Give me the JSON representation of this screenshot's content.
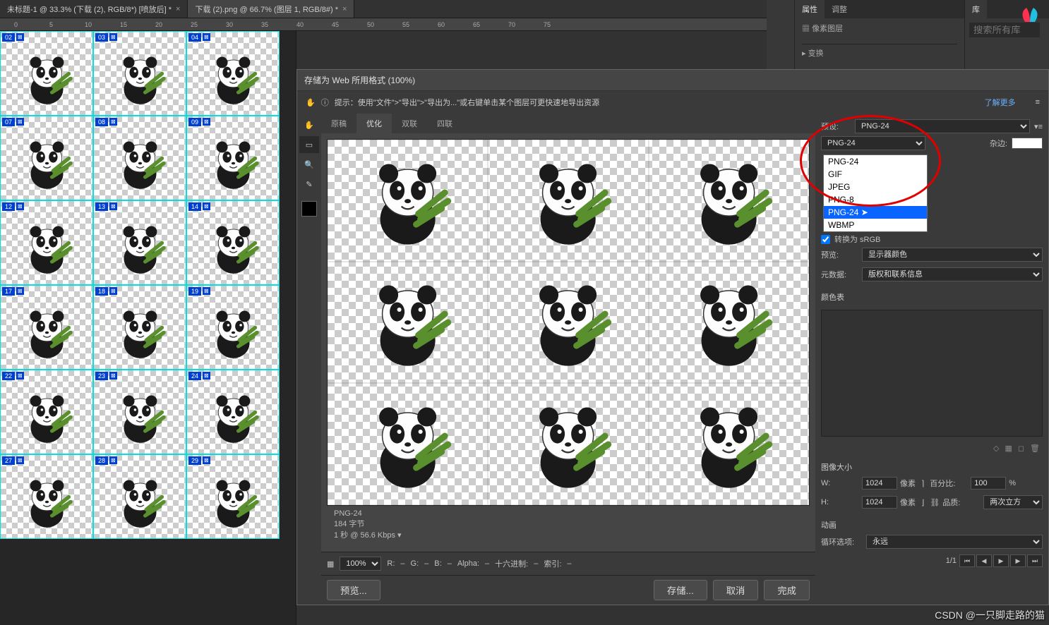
{
  "tabs": [
    {
      "label": "未标题-1 @ 33.3% (下载 (2), RGB/8*) [喷放后] *"
    },
    {
      "label": "下载 (2).png @ 66.7% (图层 1, RGB/8#) *"
    }
  ],
  "ruler_marks": [
    "0",
    "5",
    "10",
    "15",
    "20",
    "25",
    "30",
    "35",
    "40",
    "45",
    "50",
    "55",
    "60",
    "65",
    "70",
    "75"
  ],
  "thumbs": [
    "02",
    "03",
    "04",
    "07",
    "08",
    "09",
    "12",
    "13",
    "14",
    "17",
    "18",
    "19",
    "22",
    "23",
    "24",
    "27",
    "28",
    "29"
  ],
  "dialog": {
    "title": "存储为 Web 所用格式 (100%)",
    "tip": "提示：使用\"文件\">\"导出\">\"导出为...\"或右键单击某个图层可更快速地导出资源",
    "learn_more": "了解更多",
    "view_tabs": {
      "original": "原稿",
      "optimized": "优化",
      "two_up": "双联",
      "four_up": "四联"
    },
    "preset_label": "预设:",
    "preset_value": "PNG-24",
    "format_options": [
      "PNG-24",
      "GIF",
      "JPEG",
      "PNG-8",
      "PNG-24",
      "WBMP"
    ],
    "matte_label": "杂边:",
    "convert_label": "转换为 sRGB",
    "preview_label": "预览:",
    "preview_value": "显示器颜色",
    "metadata_label": "元数据:",
    "metadata_value": "版权和联系信息",
    "color_table": "颜色表",
    "image_size": "图像大小",
    "w_label": "W:",
    "w_value": "1024",
    "h_label": "H:",
    "h_value": "1024",
    "px": "像素",
    "pct_label": "百分比:",
    "pct_value": "100",
    "pct_unit": "%",
    "quality_label": "品质:",
    "quality_value": "两次立方",
    "anim": "动画",
    "loop_label": "循环选项:",
    "loop_value": "永远",
    "frame": "1/1",
    "info_format": "PNG-24",
    "info_size": "184 字节",
    "info_time": "1 秒 @ 56.6 Kbps",
    "zoom": "100%",
    "r": "R:",
    "g": "G:",
    "b": "B:",
    "alpha": "Alpha:",
    "hex": "十六进制:",
    "index": "索引:",
    "preview_btn": "预览...",
    "save": "存储...",
    "cancel": "取消",
    "done": "完成"
  },
  "panels": {
    "properties": "属性",
    "adjustments": "调整",
    "library": "库",
    "pixel_layer": "像素图层",
    "transform": "变换",
    "search_ph": "搜索所有库"
  },
  "watermark": "CSDN @一只脚走路的猫"
}
